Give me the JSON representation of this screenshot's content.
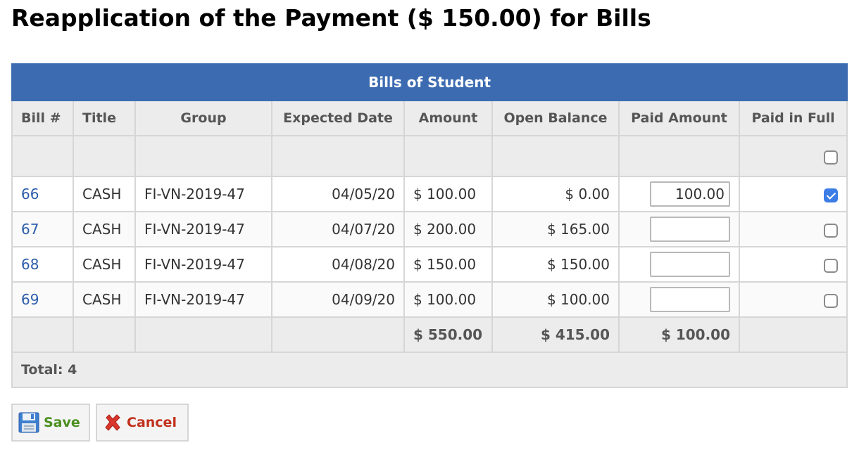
{
  "page": {
    "title": "Reapplication of the Payment ($ 150.00) for Bills"
  },
  "table": {
    "caption": "Bills of Student",
    "columns": [
      "Bill #",
      "Title",
      "Group",
      "Expected Date",
      "Amount",
      "Open Balance",
      "Paid Amount",
      "Paid in Full"
    ],
    "rows": [
      {
        "bill": "66",
        "title": "CASH",
        "group": "FI-VN-2019-47",
        "date": "04/05/20",
        "amount": "$ 100.00",
        "open_balance": "$ 0.00",
        "paid_amount": "100.00",
        "paid_in_full": true
      },
      {
        "bill": "67",
        "title": "CASH",
        "group": "FI-VN-2019-47",
        "date": "04/07/20",
        "amount": "$ 200.00",
        "open_balance": "$ 165.00",
        "paid_amount": "",
        "paid_in_full": false
      },
      {
        "bill": "68",
        "title": "CASH",
        "group": "FI-VN-2019-47",
        "date": "04/08/20",
        "amount": "$ 150.00",
        "open_balance": "$ 150.00",
        "paid_amount": "",
        "paid_in_full": false
      },
      {
        "bill": "69",
        "title": "CASH",
        "group": "FI-VN-2019-47",
        "date": "04/09/20",
        "amount": "$ 100.00",
        "open_balance": "$ 100.00",
        "paid_amount": "",
        "paid_in_full": false
      }
    ],
    "totals": {
      "amount": "$ 550.00",
      "open_balance": "$ 415.00",
      "paid_amount": "$ 100.00"
    },
    "total_count_label": "Total: 4",
    "select_all_checked": false
  },
  "buttons": {
    "save_label": "Save",
    "cancel_label": "Cancel"
  },
  "colors": {
    "header_blue": "#3c6bb1",
    "link_blue": "#2a5caa",
    "save_green": "#4a8f1e",
    "cancel_red": "#c1311c"
  },
  "icons": {
    "save": "floppy-disk-icon",
    "cancel": "red-x-icon"
  }
}
